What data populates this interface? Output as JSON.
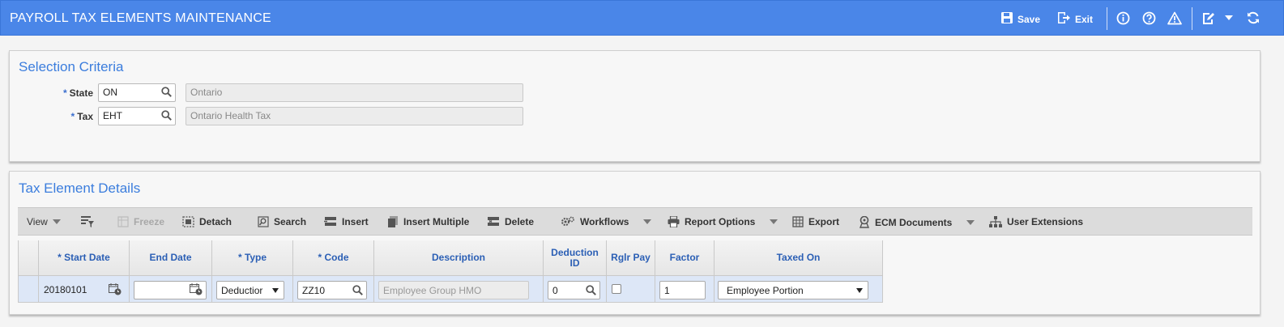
{
  "header": {
    "title": "PAYROLL TAX ELEMENTS MAINTENANCE",
    "save_label": "Save",
    "exit_label": "Exit"
  },
  "selection": {
    "title": "Selection Criteria",
    "state_label": "State",
    "state_value": "ON",
    "state_desc": "Ontario",
    "tax_label": "Tax",
    "tax_value": "EHT",
    "tax_desc": "Ontario Health Tax",
    "required_mark": "*"
  },
  "details": {
    "title": "Tax Element Details",
    "toolbar": {
      "view": "View",
      "freeze": "Freeze",
      "detach": "Detach",
      "search": "Search",
      "insert": "Insert",
      "insert_multiple": "Insert Multiple",
      "delete": "Delete",
      "workflows": "Workflows",
      "report_options": "Report Options",
      "export": "Export",
      "ecm_documents": "ECM Documents",
      "user_extensions": "User Extensions"
    },
    "columns": {
      "start_date": "* Start Date",
      "end_date": "End Date",
      "type": "* Type",
      "code": "* Code",
      "description": "Description",
      "deduction_id_1": "Deduction",
      "deduction_id_2": "ID",
      "rglr_pay": "Rglr Pay",
      "factor": "Factor",
      "taxed_on": "Taxed On"
    },
    "rows": [
      {
        "start_date": "20180101",
        "end_date": "",
        "type": "Deductior",
        "code": "ZZ10",
        "description": "Employee Group HMO",
        "deduction_id": "0",
        "rglr_pay": false,
        "factor": "1",
        "taxed_on": "Employee Portion"
      }
    ]
  },
  "colors": {
    "header_bg": "#4a86e8",
    "section_title": "#3b7ddd",
    "grid_header_text": "#2b5fb5",
    "row_bg": "#dde7f7"
  }
}
